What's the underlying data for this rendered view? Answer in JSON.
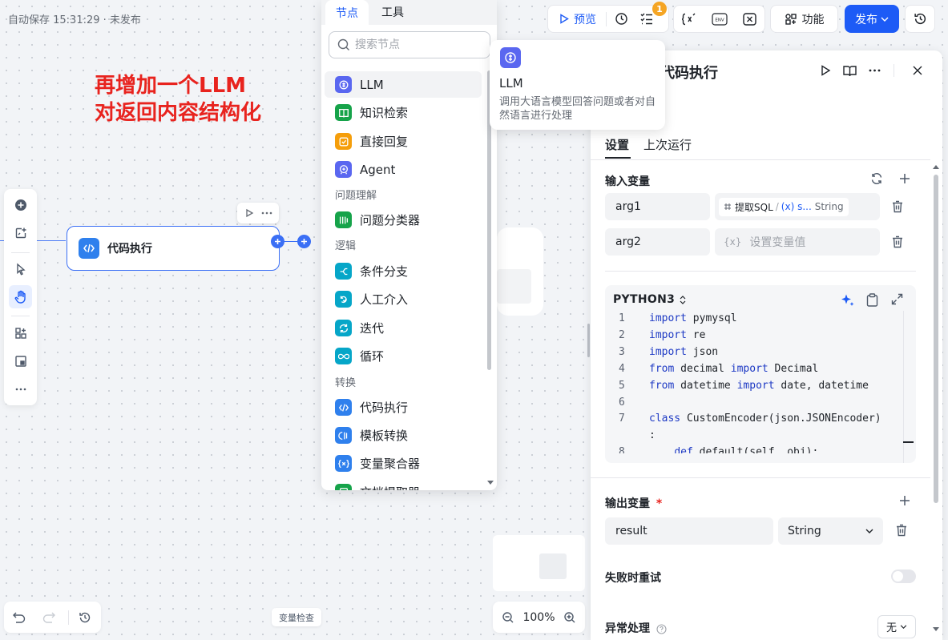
{
  "autosave": "自动保存 15:31:29 · 未发布",
  "annotation": {
    "line1": "再增加一个LLM",
    "line2": "对返回内容结构化"
  },
  "left_toolbar": {
    "icons": [
      "add-node-icon",
      "comment-icon",
      "pointer-icon",
      "hand-icon",
      "layout-icon",
      "minimap-icon",
      "more-icon"
    ],
    "active": "hand-icon"
  },
  "canvas": {
    "node": {
      "title": "代码执行",
      "icon": "code-icon"
    }
  },
  "bottom": {
    "var_check": "变量检查",
    "zoom": "100%"
  },
  "top_toolbar": {
    "preview": "预览",
    "checklist_badge": "1",
    "function": "功能",
    "publish": "发布",
    "icons": [
      "checklist-icon",
      "run-history-icon",
      "variable-check-icon",
      "env-icon",
      "variable-icon",
      "history-icon"
    ]
  },
  "node_panel": {
    "tabs": [
      "节点",
      "工具"
    ],
    "active_tab": "节点",
    "search_placeholder": "搜索节点",
    "groups": {
      "question": "问题理解",
      "logic": "逻辑",
      "transform": "转换"
    },
    "items": [
      {
        "label": "LLM",
        "color": "#5a67f0",
        "icon": "llm-icon"
      },
      {
        "label": "知识检索",
        "color": "#16a34a",
        "icon": "book-icon"
      },
      {
        "label": "直接回复",
        "color": "#f59e0b",
        "icon": "reply-icon"
      },
      {
        "label": "Agent",
        "color": "#5a67f0",
        "icon": "agent-icon"
      },
      {
        "label": "问题分类器",
        "color": "#16a34a",
        "icon": "classifier-icon"
      },
      {
        "label": "条件分支",
        "color": "#06a6c8",
        "icon": "branch-icon"
      },
      {
        "label": "人工介入",
        "color": "#06a6c8",
        "icon": "human-icon"
      },
      {
        "label": "迭代",
        "color": "#06a6c8",
        "icon": "iterate-icon"
      },
      {
        "label": "循环",
        "color": "#06a6c8",
        "icon": "loop-icon"
      },
      {
        "label": "代码执行",
        "color": "#2f80ed",
        "icon": "code-icon"
      },
      {
        "label": "模板转换",
        "color": "#2f80ed",
        "icon": "template-icon"
      },
      {
        "label": "变量聚合器",
        "color": "#2f80ed",
        "icon": "aggregator-icon"
      },
      {
        "label": "文档提取器",
        "color": "#16a34a",
        "icon": "doc-extract-icon"
      }
    ]
  },
  "tooltip": {
    "title": "LLM",
    "desc": "调用大语言模型回答问题或者对自然语言进行处理"
  },
  "panel": {
    "title": "代码执行",
    "tabs": [
      "设置",
      "上次运行"
    ],
    "input_section": "输入变量",
    "inputs": [
      {
        "name": "arg1",
        "ref_node": "提取SQL",
        "ref_var": "(x) s...",
        "ref_type": "String"
      },
      {
        "name": "arg2",
        "placeholder": "设置变量值",
        "placeholder_prefix": "{x}"
      }
    ],
    "code": {
      "language": "PYTHON3",
      "lines": [
        {
          "n": "1",
          "parts": [
            [
              "kw",
              "import"
            ],
            [
              "tx",
              " pymysql"
            ]
          ]
        },
        {
          "n": "2",
          "parts": [
            [
              "kw",
              "import"
            ],
            [
              "tx",
              " re"
            ]
          ]
        },
        {
          "n": "3",
          "parts": [
            [
              "kw",
              "import"
            ],
            [
              "tx",
              " json"
            ]
          ]
        },
        {
          "n": "4",
          "parts": [
            [
              "kw",
              "from"
            ],
            [
              "tx",
              " decimal "
            ],
            [
              "kw",
              "import"
            ],
            [
              "tx",
              " Decimal"
            ]
          ]
        },
        {
          "n": "5",
          "parts": [
            [
              "kw",
              "from"
            ],
            [
              "tx",
              " datetime "
            ],
            [
              "kw",
              "import"
            ],
            [
              "tx",
              " date, datetime"
            ]
          ]
        },
        {
          "n": "6",
          "parts": []
        },
        {
          "n": "7",
          "parts": [
            [
              "kw",
              "class"
            ],
            [
              "tx",
              " CustomEncoder(json.JSONEncoder)"
            ]
          ]
        },
        {
          "n": "",
          "parts": [
            [
              "tx",
              ":"
            ]
          ]
        },
        {
          "n": "8",
          "parts": [
            [
              "tx",
              "    "
            ],
            [
              "kw",
              "def"
            ],
            [
              "tx",
              " default(self, obj):"
            ]
          ]
        }
      ]
    },
    "output_section": "输出变量",
    "output": {
      "name": "result",
      "type": "String"
    },
    "retry_label": "失败时重试",
    "retry_enabled": false,
    "exception_label": "异常处理",
    "exception_value": "无"
  }
}
